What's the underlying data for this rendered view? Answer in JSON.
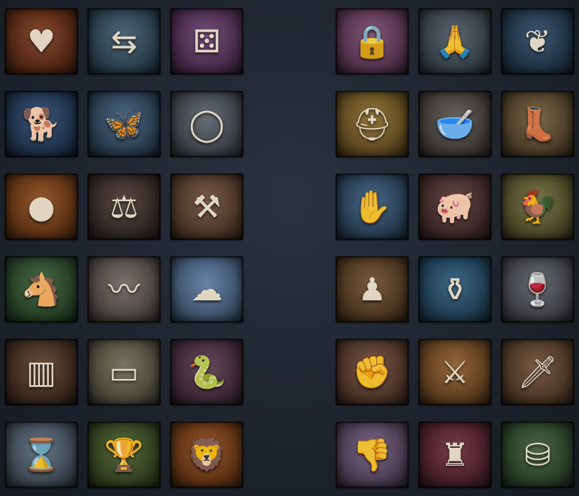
{
  "tiles": [
    {
      "icon": "flaming-heart-icon",
      "glyph": "♥",
      "color": "#7a3a1e"
    },
    {
      "icon": "signpost-icon",
      "glyph": "⇆",
      "color": "#3e5a6e"
    },
    {
      "icon": "dice-icon",
      "glyph": "⚄",
      "color": "#6a3f6e"
    },
    {
      "icon": "padlocks-icon",
      "glyph": "🔒",
      "color": "#7a4a6e"
    },
    {
      "icon": "praying-hands-icon",
      "glyph": "🙏",
      "color": "#4e5a66"
    },
    {
      "icon": "olive-branch-icon",
      "glyph": "❦",
      "color": "#2e4a66"
    },
    {
      "icon": "dog-icon",
      "glyph": "🐕",
      "color": "#2e4a6e"
    },
    {
      "icon": "butterfly-icon",
      "glyph": "🦋",
      "color": "#3e5a76"
    },
    {
      "icon": "ring-icon",
      "glyph": "◯",
      "color": "#59606a"
    },
    {
      "icon": "fallen-helmet-icon",
      "glyph": "⛑",
      "color": "#8a6a2e"
    },
    {
      "icon": "bowl-spoon-icon",
      "glyph": "🥣",
      "color": "#5a5650"
    },
    {
      "icon": "boots-icon",
      "glyph": "👢",
      "color": "#6e5a3a"
    },
    {
      "icon": "bald-head-icon",
      "glyph": "●",
      "color": "#8a4a1e"
    },
    {
      "icon": "scales-icon",
      "glyph": "⚖",
      "color": "#4a3a36"
    },
    {
      "icon": "hammer-icon",
      "glyph": "⚒",
      "color": "#6e4e3a"
    },
    {
      "icon": "hand-on-chest-icon",
      "glyph": "✋",
      "color": "#3a5a7a"
    },
    {
      "icon": "pig-icon",
      "glyph": "🐖",
      "color": "#5a3a3a"
    },
    {
      "icon": "chicken-icon",
      "glyph": "🐓",
      "color": "#6e6a3a"
    },
    {
      "icon": "donkey-icon",
      "glyph": "🐴",
      "color": "#3a5e3a"
    },
    {
      "icon": "whip-icon",
      "glyph": "〰",
      "color": "#6e6660"
    },
    {
      "icon": "clouds-icon",
      "glyph": "☁",
      "color": "#5a7aa0"
    },
    {
      "icon": "pawn-icon",
      "glyph": "♟",
      "color": "#6e4e2e"
    },
    {
      "icon": "coin-pot-icon",
      "glyph": "⚱",
      "color": "#2e5a7a"
    },
    {
      "icon": "goblets-icon",
      "glyph": "🍷",
      "color": "#5a5e66"
    },
    {
      "icon": "face-behind-bars-icon",
      "glyph": "▥",
      "color": "#5a3e2e"
    },
    {
      "icon": "pillow-icon",
      "glyph": "▭",
      "color": "#6e6a56"
    },
    {
      "icon": "snake-icon",
      "glyph": "🐍",
      "color": "#5a3a4e"
    },
    {
      "icon": "gauntlet-fist-icon",
      "glyph": "✊",
      "color": "#6e4a3a"
    },
    {
      "icon": "fallen-soldier-icon",
      "glyph": "⚔",
      "color": "#8a5a2e"
    },
    {
      "icon": "dagger-icon",
      "glyph": "🗡",
      "color": "#6e4e36"
    },
    {
      "icon": "hourglass-icon",
      "glyph": "⌛",
      "color": "#5a6a7a"
    },
    {
      "icon": "chalice-icon",
      "glyph": "🏆",
      "color": "#4a5e2e"
    },
    {
      "icon": "lion-icon",
      "glyph": "🦁",
      "color": "#8a4a1e"
    },
    {
      "icon": "thumbs-down-icon",
      "glyph": "👎",
      "color": "#6e5a7a"
    },
    {
      "icon": "robed-figure-icon",
      "glyph": "♜",
      "color": "#6a2e3e"
    },
    {
      "icon": "gold-coins-icon",
      "glyph": "⛁",
      "color": "#3e5a3a"
    }
  ]
}
